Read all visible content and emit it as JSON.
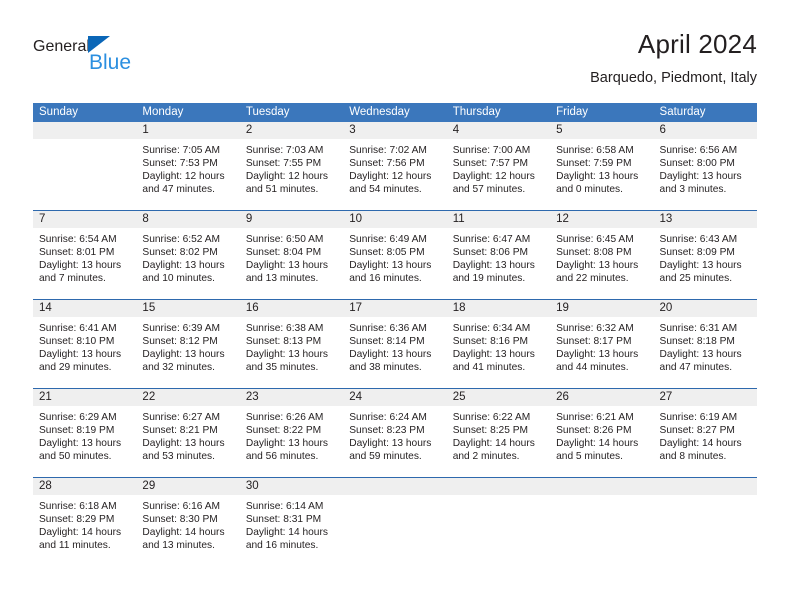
{
  "brand": {
    "name_part1": "General",
    "name_part2": "Blue",
    "triangle_color": "#0a66b7",
    "blue_text_color": "#2b8fe0"
  },
  "header": {
    "title": "April 2024",
    "subtitle": "Barquedo, Piedmont, Italy"
  },
  "theme": {
    "header_blue": "#3b77bc",
    "week_divider_blue": "#2e69ad",
    "day_band_gray": "#efefef",
    "text_color": "#231f20"
  },
  "weekdays": [
    "Sunday",
    "Monday",
    "Tuesday",
    "Wednesday",
    "Thursday",
    "Friday",
    "Saturday"
  ],
  "weeks": [
    [
      {
        "day": "",
        "sunrise": "",
        "sunset": "",
        "daylight_line1": "",
        "daylight_line2": ""
      },
      {
        "day": "1",
        "sunrise": "Sunrise: 7:05 AM",
        "sunset": "Sunset: 7:53 PM",
        "daylight_line1": "Daylight: 12 hours",
        "daylight_line2": "and 47 minutes."
      },
      {
        "day": "2",
        "sunrise": "Sunrise: 7:03 AM",
        "sunset": "Sunset: 7:55 PM",
        "daylight_line1": "Daylight: 12 hours",
        "daylight_line2": "and 51 minutes."
      },
      {
        "day": "3",
        "sunrise": "Sunrise: 7:02 AM",
        "sunset": "Sunset: 7:56 PM",
        "daylight_line1": "Daylight: 12 hours",
        "daylight_line2": "and 54 minutes."
      },
      {
        "day": "4",
        "sunrise": "Sunrise: 7:00 AM",
        "sunset": "Sunset: 7:57 PM",
        "daylight_line1": "Daylight: 12 hours",
        "daylight_line2": "and 57 minutes."
      },
      {
        "day": "5",
        "sunrise": "Sunrise: 6:58 AM",
        "sunset": "Sunset: 7:59 PM",
        "daylight_line1": "Daylight: 13 hours",
        "daylight_line2": "and 0 minutes."
      },
      {
        "day": "6",
        "sunrise": "Sunrise: 6:56 AM",
        "sunset": "Sunset: 8:00 PM",
        "daylight_line1": "Daylight: 13 hours",
        "daylight_line2": "and 3 minutes."
      }
    ],
    [
      {
        "day": "7",
        "sunrise": "Sunrise: 6:54 AM",
        "sunset": "Sunset: 8:01 PM",
        "daylight_line1": "Daylight: 13 hours",
        "daylight_line2": "and 7 minutes."
      },
      {
        "day": "8",
        "sunrise": "Sunrise: 6:52 AM",
        "sunset": "Sunset: 8:02 PM",
        "daylight_line1": "Daylight: 13 hours",
        "daylight_line2": "and 10 minutes."
      },
      {
        "day": "9",
        "sunrise": "Sunrise: 6:50 AM",
        "sunset": "Sunset: 8:04 PM",
        "daylight_line1": "Daylight: 13 hours",
        "daylight_line2": "and 13 minutes."
      },
      {
        "day": "10",
        "sunrise": "Sunrise: 6:49 AM",
        "sunset": "Sunset: 8:05 PM",
        "daylight_line1": "Daylight: 13 hours",
        "daylight_line2": "and 16 minutes."
      },
      {
        "day": "11",
        "sunrise": "Sunrise: 6:47 AM",
        "sunset": "Sunset: 8:06 PM",
        "daylight_line1": "Daylight: 13 hours",
        "daylight_line2": "and 19 minutes."
      },
      {
        "day": "12",
        "sunrise": "Sunrise: 6:45 AM",
        "sunset": "Sunset: 8:08 PM",
        "daylight_line1": "Daylight: 13 hours",
        "daylight_line2": "and 22 minutes."
      },
      {
        "day": "13",
        "sunrise": "Sunrise: 6:43 AM",
        "sunset": "Sunset: 8:09 PM",
        "daylight_line1": "Daylight: 13 hours",
        "daylight_line2": "and 25 minutes."
      }
    ],
    [
      {
        "day": "14",
        "sunrise": "Sunrise: 6:41 AM",
        "sunset": "Sunset: 8:10 PM",
        "daylight_line1": "Daylight: 13 hours",
        "daylight_line2": "and 29 minutes."
      },
      {
        "day": "15",
        "sunrise": "Sunrise: 6:39 AM",
        "sunset": "Sunset: 8:12 PM",
        "daylight_line1": "Daylight: 13 hours",
        "daylight_line2": "and 32 minutes."
      },
      {
        "day": "16",
        "sunrise": "Sunrise: 6:38 AM",
        "sunset": "Sunset: 8:13 PM",
        "daylight_line1": "Daylight: 13 hours",
        "daylight_line2": "and 35 minutes."
      },
      {
        "day": "17",
        "sunrise": "Sunrise: 6:36 AM",
        "sunset": "Sunset: 8:14 PM",
        "daylight_line1": "Daylight: 13 hours",
        "daylight_line2": "and 38 minutes."
      },
      {
        "day": "18",
        "sunrise": "Sunrise: 6:34 AM",
        "sunset": "Sunset: 8:16 PM",
        "daylight_line1": "Daylight: 13 hours",
        "daylight_line2": "and 41 minutes."
      },
      {
        "day": "19",
        "sunrise": "Sunrise: 6:32 AM",
        "sunset": "Sunset: 8:17 PM",
        "daylight_line1": "Daylight: 13 hours",
        "daylight_line2": "and 44 minutes."
      },
      {
        "day": "20",
        "sunrise": "Sunrise: 6:31 AM",
        "sunset": "Sunset: 8:18 PM",
        "daylight_line1": "Daylight: 13 hours",
        "daylight_line2": "and 47 minutes."
      }
    ],
    [
      {
        "day": "21",
        "sunrise": "Sunrise: 6:29 AM",
        "sunset": "Sunset: 8:19 PM",
        "daylight_line1": "Daylight: 13 hours",
        "daylight_line2": "and 50 minutes."
      },
      {
        "day": "22",
        "sunrise": "Sunrise: 6:27 AM",
        "sunset": "Sunset: 8:21 PM",
        "daylight_line1": "Daylight: 13 hours",
        "daylight_line2": "and 53 minutes."
      },
      {
        "day": "23",
        "sunrise": "Sunrise: 6:26 AM",
        "sunset": "Sunset: 8:22 PM",
        "daylight_line1": "Daylight: 13 hours",
        "daylight_line2": "and 56 minutes."
      },
      {
        "day": "24",
        "sunrise": "Sunrise: 6:24 AM",
        "sunset": "Sunset: 8:23 PM",
        "daylight_line1": "Daylight: 13 hours",
        "daylight_line2": "and 59 minutes."
      },
      {
        "day": "25",
        "sunrise": "Sunrise: 6:22 AM",
        "sunset": "Sunset: 8:25 PM",
        "daylight_line1": "Daylight: 14 hours",
        "daylight_line2": "and 2 minutes."
      },
      {
        "day": "26",
        "sunrise": "Sunrise: 6:21 AM",
        "sunset": "Sunset: 8:26 PM",
        "daylight_line1": "Daylight: 14 hours",
        "daylight_line2": "and 5 minutes."
      },
      {
        "day": "27",
        "sunrise": "Sunrise: 6:19 AM",
        "sunset": "Sunset: 8:27 PM",
        "daylight_line1": "Daylight: 14 hours",
        "daylight_line2": "and 8 minutes."
      }
    ],
    [
      {
        "day": "28",
        "sunrise": "Sunrise: 6:18 AM",
        "sunset": "Sunset: 8:29 PM",
        "daylight_line1": "Daylight: 14 hours",
        "daylight_line2": "and 11 minutes."
      },
      {
        "day": "29",
        "sunrise": "Sunrise: 6:16 AM",
        "sunset": "Sunset: 8:30 PM",
        "daylight_line1": "Daylight: 14 hours",
        "daylight_line2": "and 13 minutes."
      },
      {
        "day": "30",
        "sunrise": "Sunrise: 6:14 AM",
        "sunset": "Sunset: 8:31 PM",
        "daylight_line1": "Daylight: 14 hours",
        "daylight_line2": "and 16 minutes."
      },
      {
        "day": "",
        "sunrise": "",
        "sunset": "",
        "daylight_line1": "",
        "daylight_line2": ""
      },
      {
        "day": "",
        "sunrise": "",
        "sunset": "",
        "daylight_line1": "",
        "daylight_line2": ""
      },
      {
        "day": "",
        "sunrise": "",
        "sunset": "",
        "daylight_line1": "",
        "daylight_line2": ""
      },
      {
        "day": "",
        "sunrise": "",
        "sunset": "",
        "daylight_line1": "",
        "daylight_line2": ""
      }
    ]
  ]
}
